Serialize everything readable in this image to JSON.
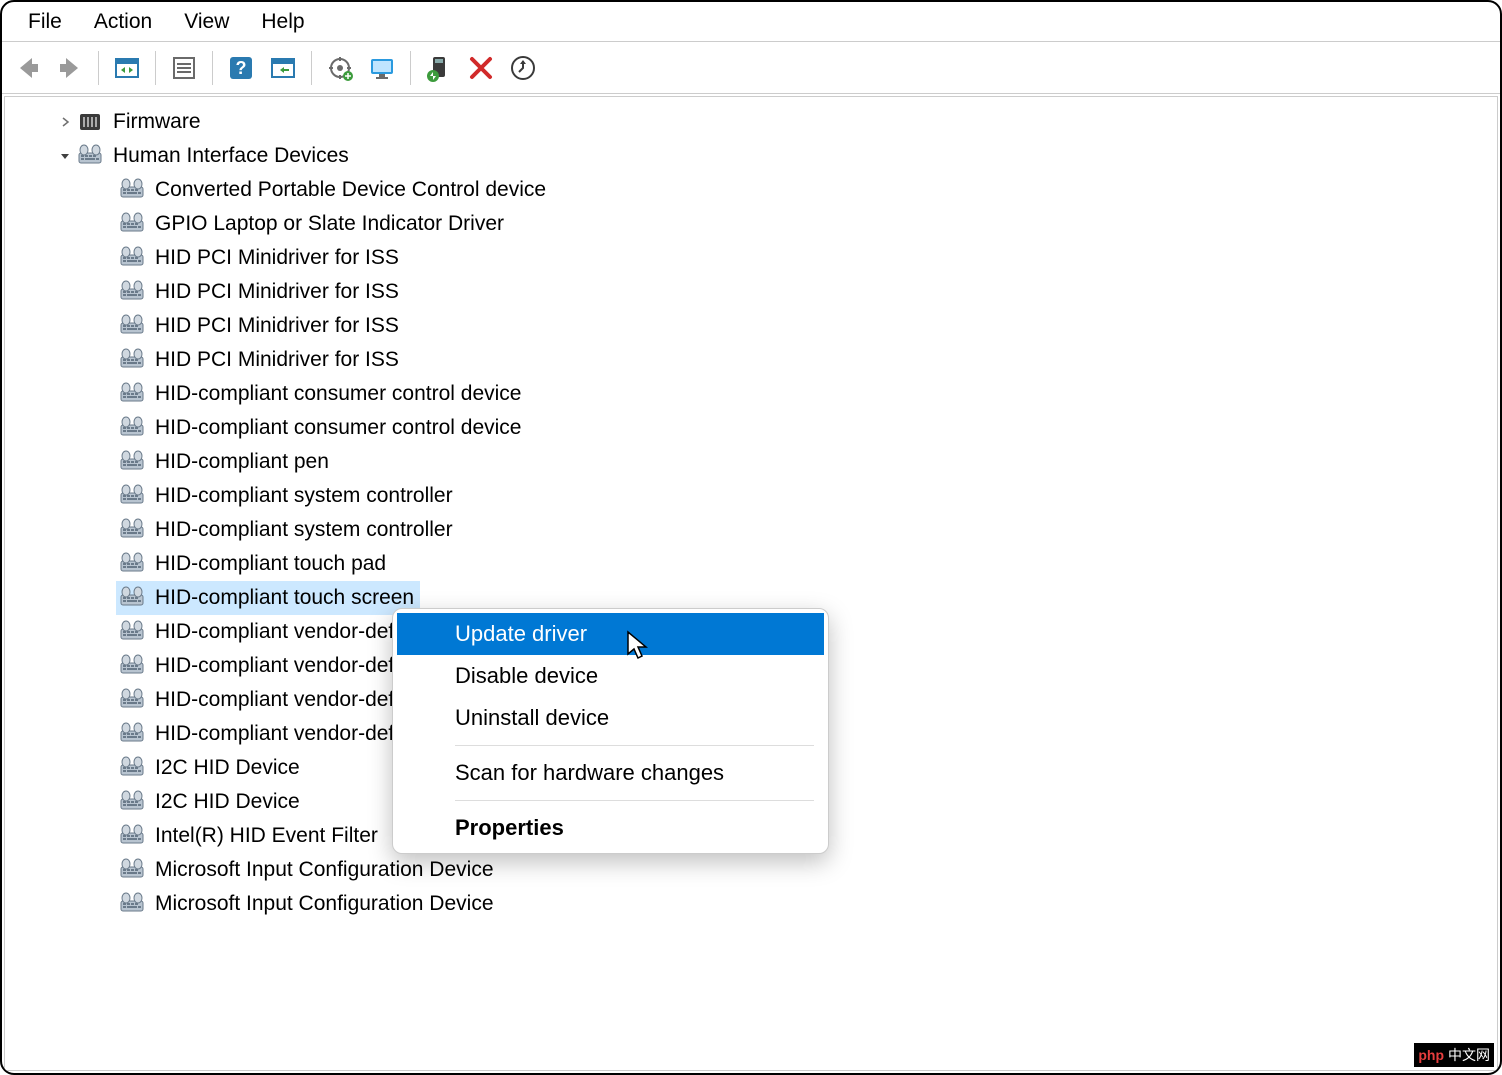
{
  "menu": {
    "file": "File",
    "action": "Action",
    "view": "View",
    "help": "Help"
  },
  "toolbar_icons": [
    "back",
    "forward",
    "sep",
    "show-hide",
    "sep",
    "properties",
    "sep",
    "help",
    "refresh",
    "sep",
    "update",
    "monitor",
    "sep",
    "install",
    "remove",
    "scan"
  ],
  "tree": {
    "firmware": {
      "label": "Firmware",
      "expanded": false
    },
    "hid": {
      "label": "Human Interface Devices",
      "expanded": true,
      "children": [
        "Converted Portable Device Control device",
        "GPIO Laptop or Slate Indicator Driver",
        "HID PCI Minidriver for ISS",
        "HID PCI Minidriver for ISS",
        "HID PCI Minidriver for ISS",
        "HID PCI Minidriver for ISS",
        "HID-compliant consumer control device",
        "HID-compliant consumer control device",
        "HID-compliant pen",
        "HID-compliant system controller",
        "HID-compliant system controller",
        "HID-compliant touch pad",
        "HID-compliant touch screen",
        "HID-compliant vendor-defined device",
        "HID-compliant vendor-defined device",
        "HID-compliant vendor-defined device",
        "HID-compliant vendor-defined device",
        "I2C HID Device",
        "I2C HID Device",
        "Intel(R) HID Event Filter",
        "Microsoft Input Configuration Device",
        "Microsoft Input Configuration Device"
      ],
      "selected_index": 12
    }
  },
  "context_menu": {
    "items": [
      {
        "label": "Update driver",
        "highlight": true
      },
      {
        "label": "Disable device"
      },
      {
        "label": "Uninstall device"
      },
      {
        "sep": true
      },
      {
        "label": "Scan for hardware changes"
      },
      {
        "sep": true
      },
      {
        "label": "Properties",
        "bold": true
      }
    ]
  },
  "watermark": {
    "left": "php",
    "right": "中文网"
  }
}
